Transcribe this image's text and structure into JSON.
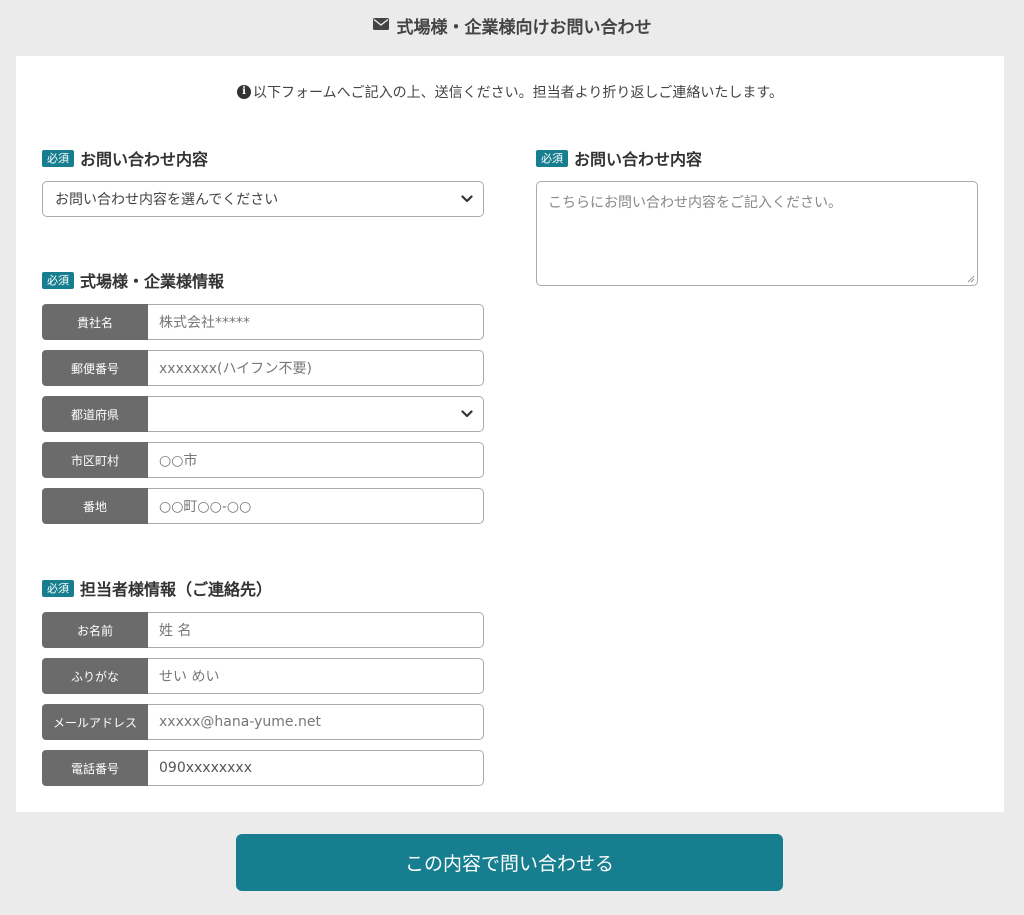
{
  "header": {
    "title": "式場様・企業様向けお問い合わせ",
    "icon": "mail-icon"
  },
  "notice": {
    "text": "以下フォームへご記入の上、送信ください。担当者より折り返しご連絡いたします。",
    "icon": "info-icon"
  },
  "required_badge": "必須",
  "inquiry_type": {
    "title": "お問い合わせ内容",
    "select_value": "お問い合わせ内容を選んでください"
  },
  "inquiry_content": {
    "title": "お問い合わせ内容",
    "placeholder": "こちらにお問い合わせ内容をご記入ください。"
  },
  "company_info": {
    "title": "式場様・企業様情報",
    "fields": [
      {
        "label": "貴社名",
        "placeholder": "株式会社*****"
      },
      {
        "label": "郵便番号",
        "placeholder": "xxxxxxx(ハイフン不要)"
      },
      {
        "label": "都道府県",
        "placeholder": ""
      },
      {
        "label": "市区町村",
        "placeholder": "○○市"
      },
      {
        "label": "番地",
        "placeholder": "○○町○○-○○"
      }
    ]
  },
  "contact_info": {
    "title": "担当者様情報（ご連絡先）",
    "fields": [
      {
        "label": "お名前",
        "placeholder": "姓 名"
      },
      {
        "label": "ふりがな",
        "placeholder": "せい めい"
      },
      {
        "label": "メールアドレス",
        "placeholder": "xxxxx@hana-yume.net"
      },
      {
        "label": "電話番号",
        "placeholder": "090xxxxxxxx"
      }
    ]
  },
  "submit": {
    "label": "この内容で問い合わせる"
  },
  "colors": {
    "accent": "#167e8f",
    "label_bg": "#6b6b6b",
    "page_bg": "#ebebeb"
  }
}
